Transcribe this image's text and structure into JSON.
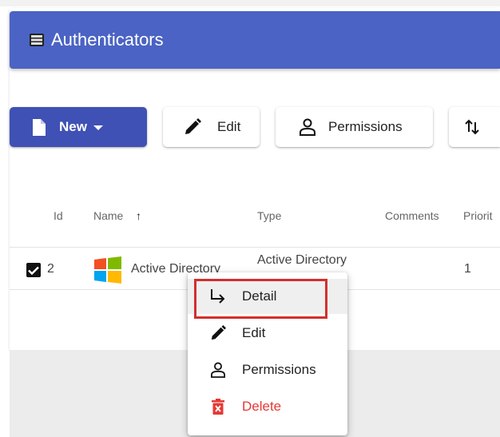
{
  "header": {
    "title": "Authenticators",
    "icon": "server-icon"
  },
  "toolbar": {
    "new_label": "New",
    "edit_label": "Edit",
    "permissions_label": "Permissions",
    "more_icon": "sort-icon"
  },
  "table": {
    "columns": [
      "Id",
      "Name",
      "Type",
      "Comments",
      "Priorit"
    ],
    "sort_indicator": "↑",
    "rows": [
      {
        "id": "2",
        "name": "Active Directory",
        "type": "Active Directory",
        "comments": "",
        "priority": "1",
        "selected": true,
        "icon": "windows-logo-icon"
      }
    ]
  },
  "context_menu": {
    "items": [
      {
        "label": "Detail",
        "icon": "detail-arrow-icon"
      },
      {
        "label": "Edit",
        "icon": "pencil-icon"
      },
      {
        "label": "Permissions",
        "icon": "person-icon"
      },
      {
        "label": "Delete",
        "icon": "trash-icon"
      }
    ]
  },
  "colors": {
    "header_bg": "#4a63c4",
    "primary_button": "#3f51b5",
    "delete": "#e53935",
    "highlight_border": "#d32f2f"
  }
}
